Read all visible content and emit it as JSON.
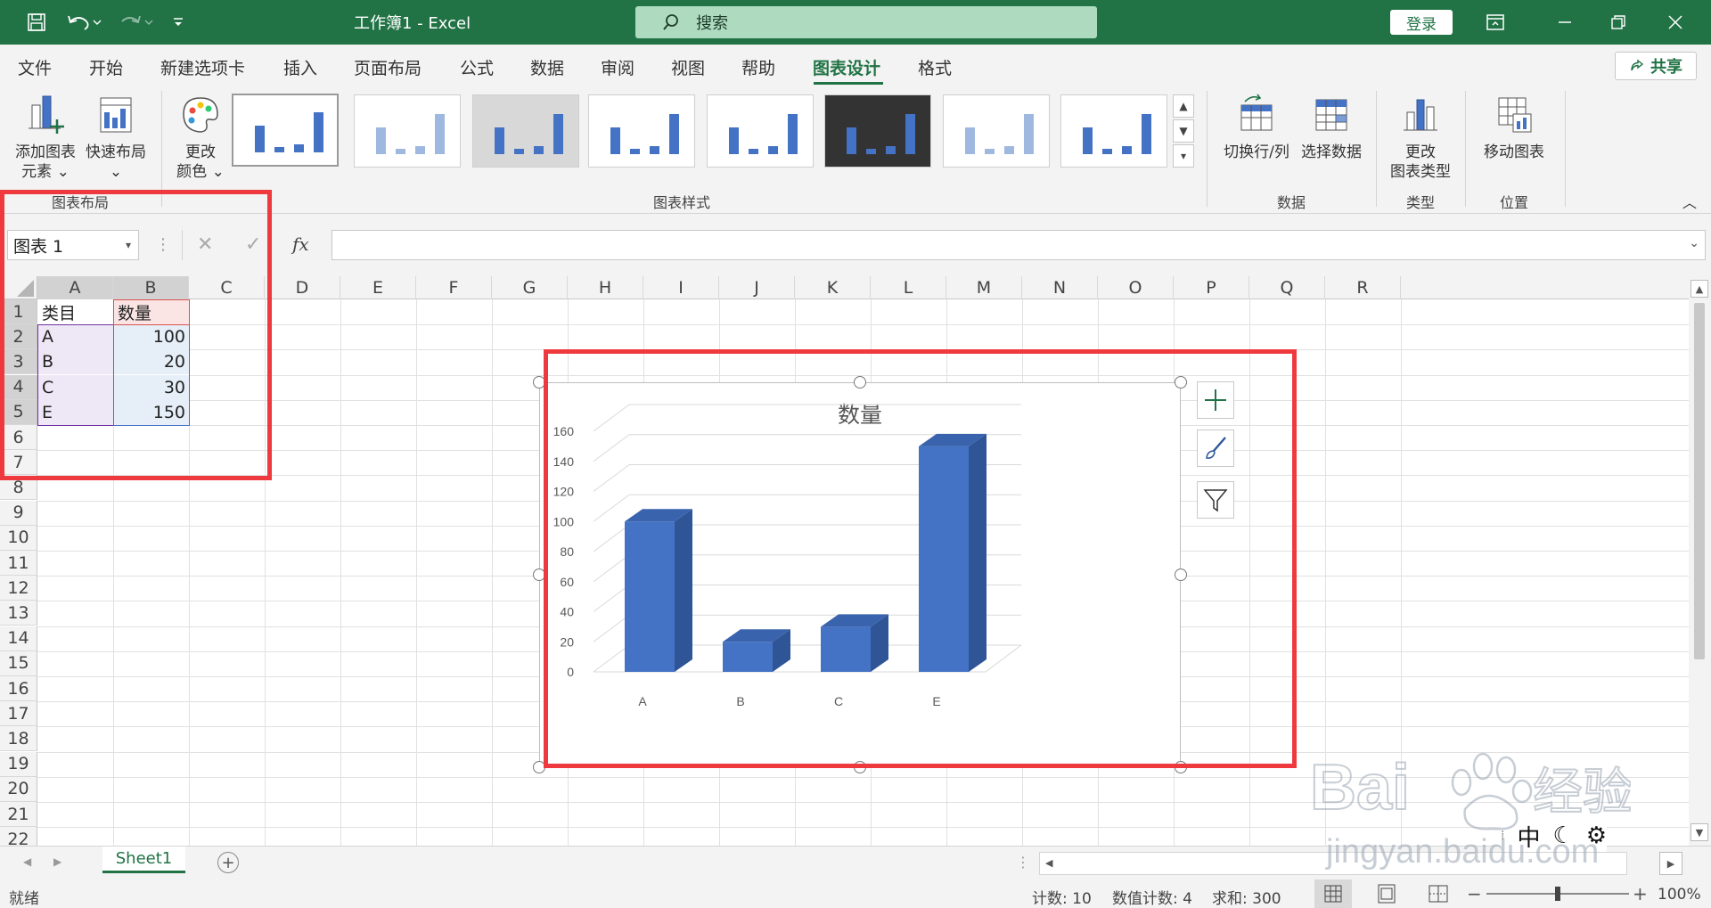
{
  "titlebar": {
    "title": "工作簿1 - Excel",
    "search_placeholder": "搜索",
    "login_label": "登录"
  },
  "menu": {
    "items": [
      "文件",
      "开始",
      "新建选项卡",
      "插入",
      "页面布局",
      "公式",
      "数据",
      "审阅",
      "视图",
      "帮助",
      "图表设计",
      "格式"
    ],
    "active": "图表设计",
    "share_label": "共享"
  },
  "ribbon": {
    "add_element": "添加图表\n元素",
    "add_element_l1": "添加图表",
    "add_element_l2": "元素",
    "quick_layout": "快速布局",
    "change_colors_l1": "更改",
    "change_colors_l2": "颜色",
    "group_layout": "图表布局",
    "group_styles": "图表样式",
    "switch_row_col": "切换行/列",
    "select_data": "选择数据",
    "group_data": "数据",
    "change_type_l1": "更改",
    "change_type_l2": "图表类型",
    "group_type": "类型",
    "move_chart": "移动图表",
    "group_location": "位置"
  },
  "formula_bar": {
    "name_box": "图表 1",
    "fx": "fx"
  },
  "grid": {
    "columns": [
      "A",
      "B",
      "C",
      "D",
      "E",
      "F",
      "G",
      "H",
      "I",
      "J",
      "K",
      "L",
      "M",
      "N",
      "O",
      "P",
      "Q",
      "R"
    ],
    "rows": [
      "1",
      "2",
      "3",
      "4",
      "5",
      "6",
      "7",
      "8",
      "9",
      "10",
      "11",
      "12",
      "13",
      "14",
      "15",
      "16",
      "17",
      "18",
      "19",
      "20",
      "21",
      "22"
    ],
    "header": {
      "a": "类目",
      "b": "数量"
    },
    "data": [
      {
        "a": "A",
        "b": "100"
      },
      {
        "a": "B",
        "b": "20"
      },
      {
        "a": "C",
        "b": "30"
      },
      {
        "a": "E",
        "b": "150"
      }
    ]
  },
  "chart_data": {
    "type": "bar",
    "title": "数量",
    "categories": [
      "A",
      "B",
      "C",
      "E"
    ],
    "values": [
      100,
      20,
      30,
      150
    ],
    "ylim": [
      0,
      160
    ],
    "yticks": [
      "0",
      "20",
      "40",
      "60",
      "80",
      "100",
      "120",
      "140",
      "160"
    ],
    "color": "#4472c4",
    "style": "3-D clustered column",
    "grid": true
  },
  "sheets": {
    "tabs": [
      "Sheet1"
    ],
    "active": "Sheet1"
  },
  "status": {
    "ready": "就绪",
    "count": "计数: 10",
    "numeric_count": "数值计数: 4",
    "sum": "求和: 300",
    "zoom": "100%"
  },
  "watermark": {
    "brand": "Baidu经验",
    "url": "jingyan.baidu.com"
  },
  "ime": {
    "label": "中"
  },
  "colors": {
    "excel_green": "#217346",
    "highlight_red": "#ee3a3f"
  }
}
